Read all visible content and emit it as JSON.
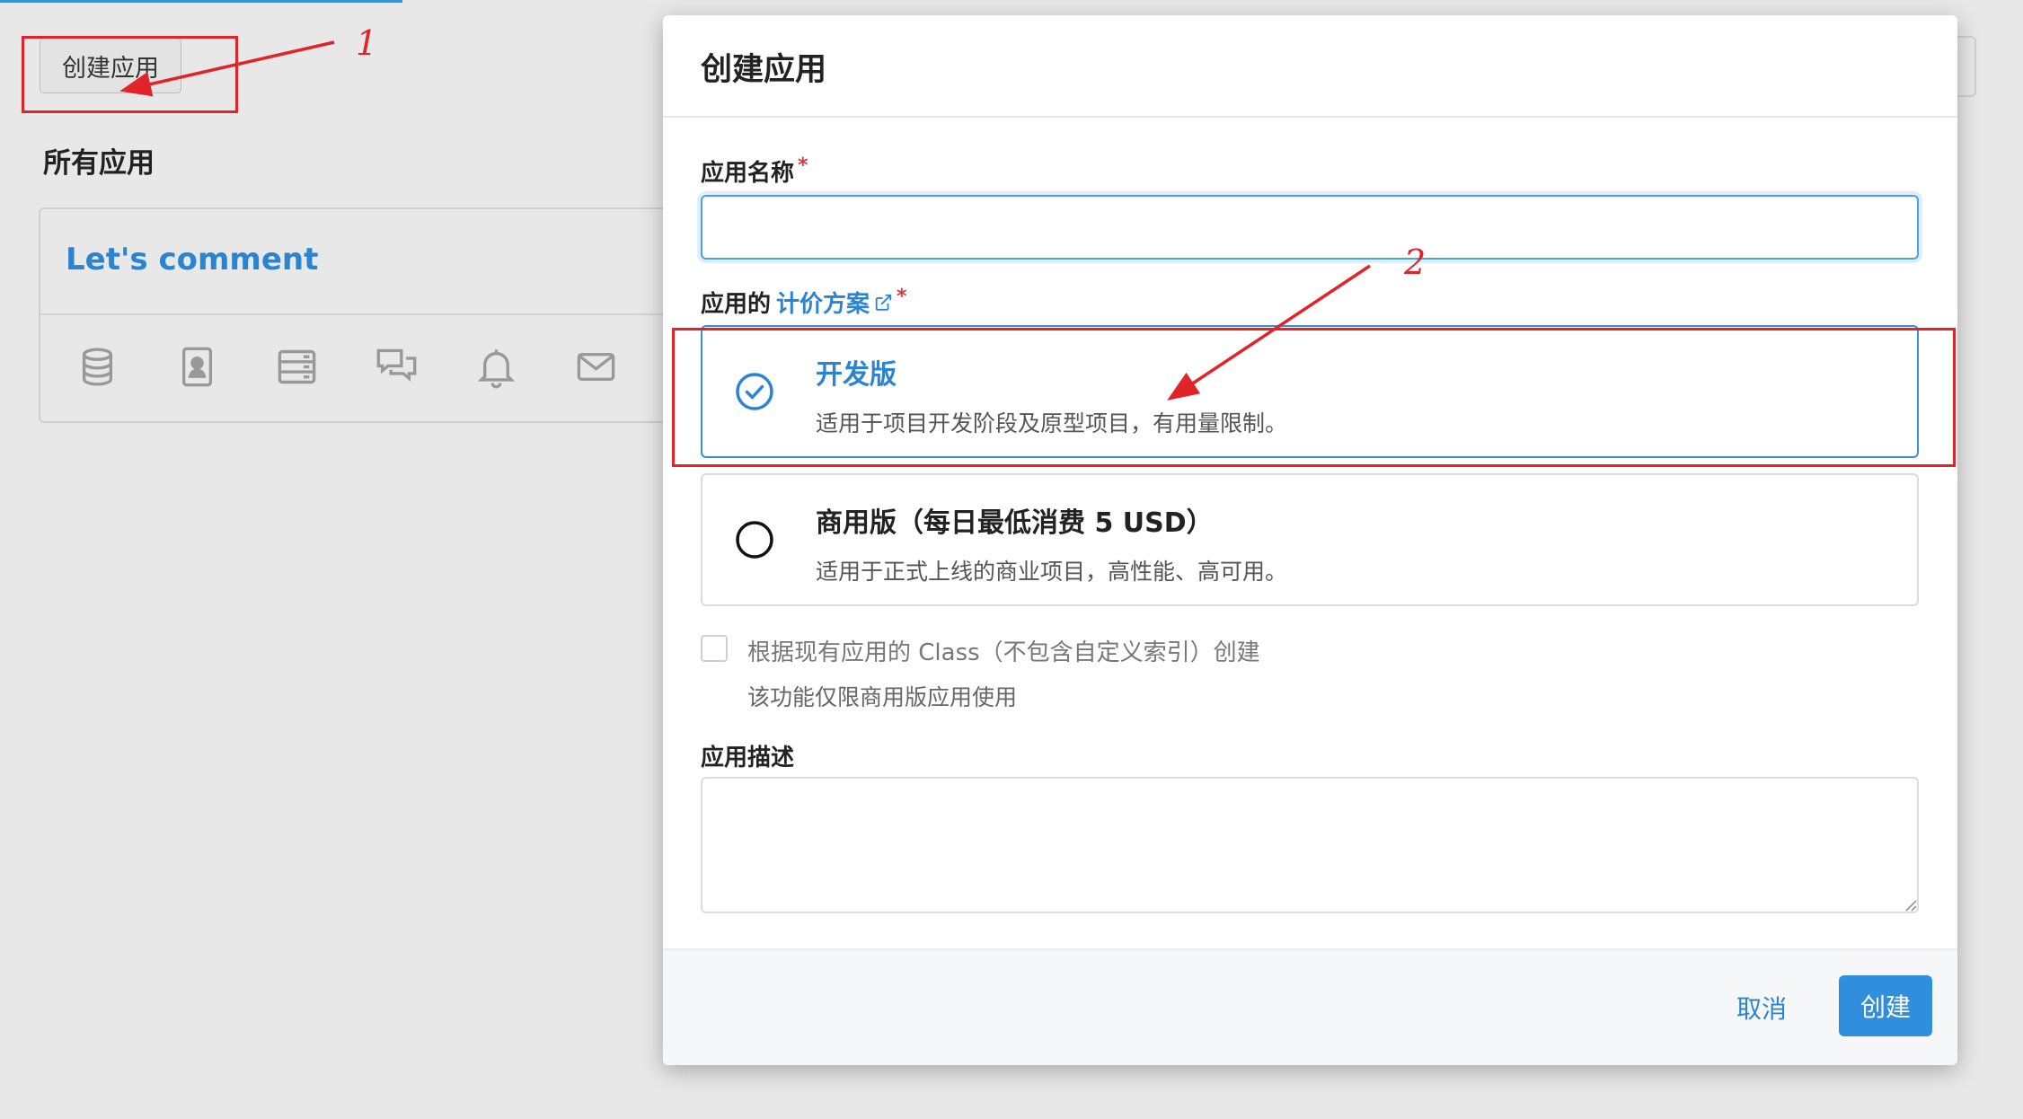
{
  "background_page": {
    "create_button_label": "创建应用",
    "all_apps_title": "所有应用",
    "app_card": {
      "title": "Let's comment",
      "icons": [
        "database-icon",
        "contact-card-icon",
        "server-list-icon",
        "chat-icon",
        "bell-icon",
        "mail-icon"
      ]
    }
  },
  "modal": {
    "title": "创建应用",
    "app_name": {
      "label": "应用名称",
      "required_mark": "*",
      "value": ""
    },
    "pricing": {
      "label_prefix": "应用的",
      "link_text": "计价方案",
      "required_mark": "*",
      "plans": [
        {
          "name": "开发版",
          "description": "适用于项目开发阶段及原型项目，有用量限制。",
          "selected": true
        },
        {
          "name": "商用版（每日最低消费 5 USD）",
          "description": "适用于正式上线的商业项目，高性能、高可用。",
          "selected": false
        }
      ]
    },
    "class_option": {
      "label": "根据现有应用的 Class（不包含自定义索引）创建",
      "help": "该功能仅限商用版应用使用",
      "checked": false
    },
    "description": {
      "label": "应用描述",
      "value": ""
    },
    "footer": {
      "cancel_label": "取消",
      "create_label": "创建"
    }
  },
  "annotations": {
    "marker_1": "1",
    "marker_2": "2",
    "color": "#e0242a"
  },
  "colors": {
    "accent": "#2a84d2",
    "primary_button": "#2f8fde",
    "annotation": "#e0242a"
  }
}
